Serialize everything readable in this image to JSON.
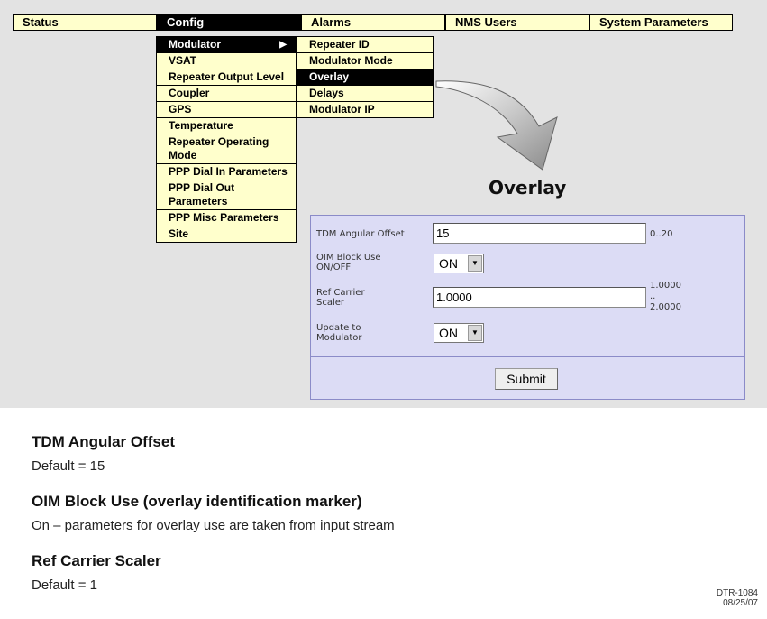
{
  "nav": {
    "items": [
      {
        "label": "Status",
        "active": false
      },
      {
        "label": "Config",
        "active": true
      },
      {
        "label": "Alarms",
        "active": false
      },
      {
        "label": "NMS Users",
        "active": false
      },
      {
        "label": "System Parameters",
        "active": false
      }
    ]
  },
  "config_menu": {
    "items": [
      {
        "label": "Modulator",
        "active": true,
        "arrow": "▶"
      },
      {
        "label": "VSAT"
      },
      {
        "label": "Repeater Output Level"
      },
      {
        "label": "Coupler"
      },
      {
        "label": "GPS"
      },
      {
        "label": "Temperature"
      },
      {
        "label": "Repeater Operating Mode"
      },
      {
        "label": "PPP Dial In Parameters"
      },
      {
        "label": "PPP Dial Out Parameters"
      },
      {
        "label": "PPP Misc Parameters"
      },
      {
        "label": "Site"
      }
    ]
  },
  "modulator_menu": {
    "items": [
      {
        "label": "Repeater ID"
      },
      {
        "label": "Modulator Mode"
      },
      {
        "label": "Overlay",
        "active": true
      },
      {
        "label": "Delays"
      },
      {
        "label": "Modulator IP"
      }
    ]
  },
  "form": {
    "title": "Overlay",
    "tdm_label": "TDM Angular Offset",
    "tdm_value": "15",
    "tdm_range": "0..20",
    "oim_label_1": "OIM Block Use",
    "oim_label_2": "ON/OFF",
    "oim_value": "ON",
    "ref_label_1": "Ref Carrier",
    "ref_label_2": "Scaler",
    "ref_value": "1.0000",
    "ref_range_1": "1.0000",
    "ref_range_2": "..",
    "ref_range_3": "2.0000",
    "upd_label_1": "Update to",
    "upd_label_2": "Modulator",
    "upd_value": "ON",
    "dropdown_glyph": "▼",
    "submit_label": "Submit"
  },
  "notes": {
    "h1": "TDM Angular Offset",
    "d1": "Default = 15",
    "h2": "OIM Block Use (overlay identification marker)",
    "d2": "On – parameters for overlay use are taken from input stream",
    "h3": "Ref Carrier Scaler",
    "d3": "Default = 1"
  },
  "footer": {
    "doc_id": "DTR-1084",
    "date": "08/25/07"
  },
  "colors": {
    "menu_bg": "#ffffcc",
    "menu_active_bg": "#000000",
    "panel_bg": "#dcdcf5",
    "screen_bg": "#e3e3e3"
  }
}
